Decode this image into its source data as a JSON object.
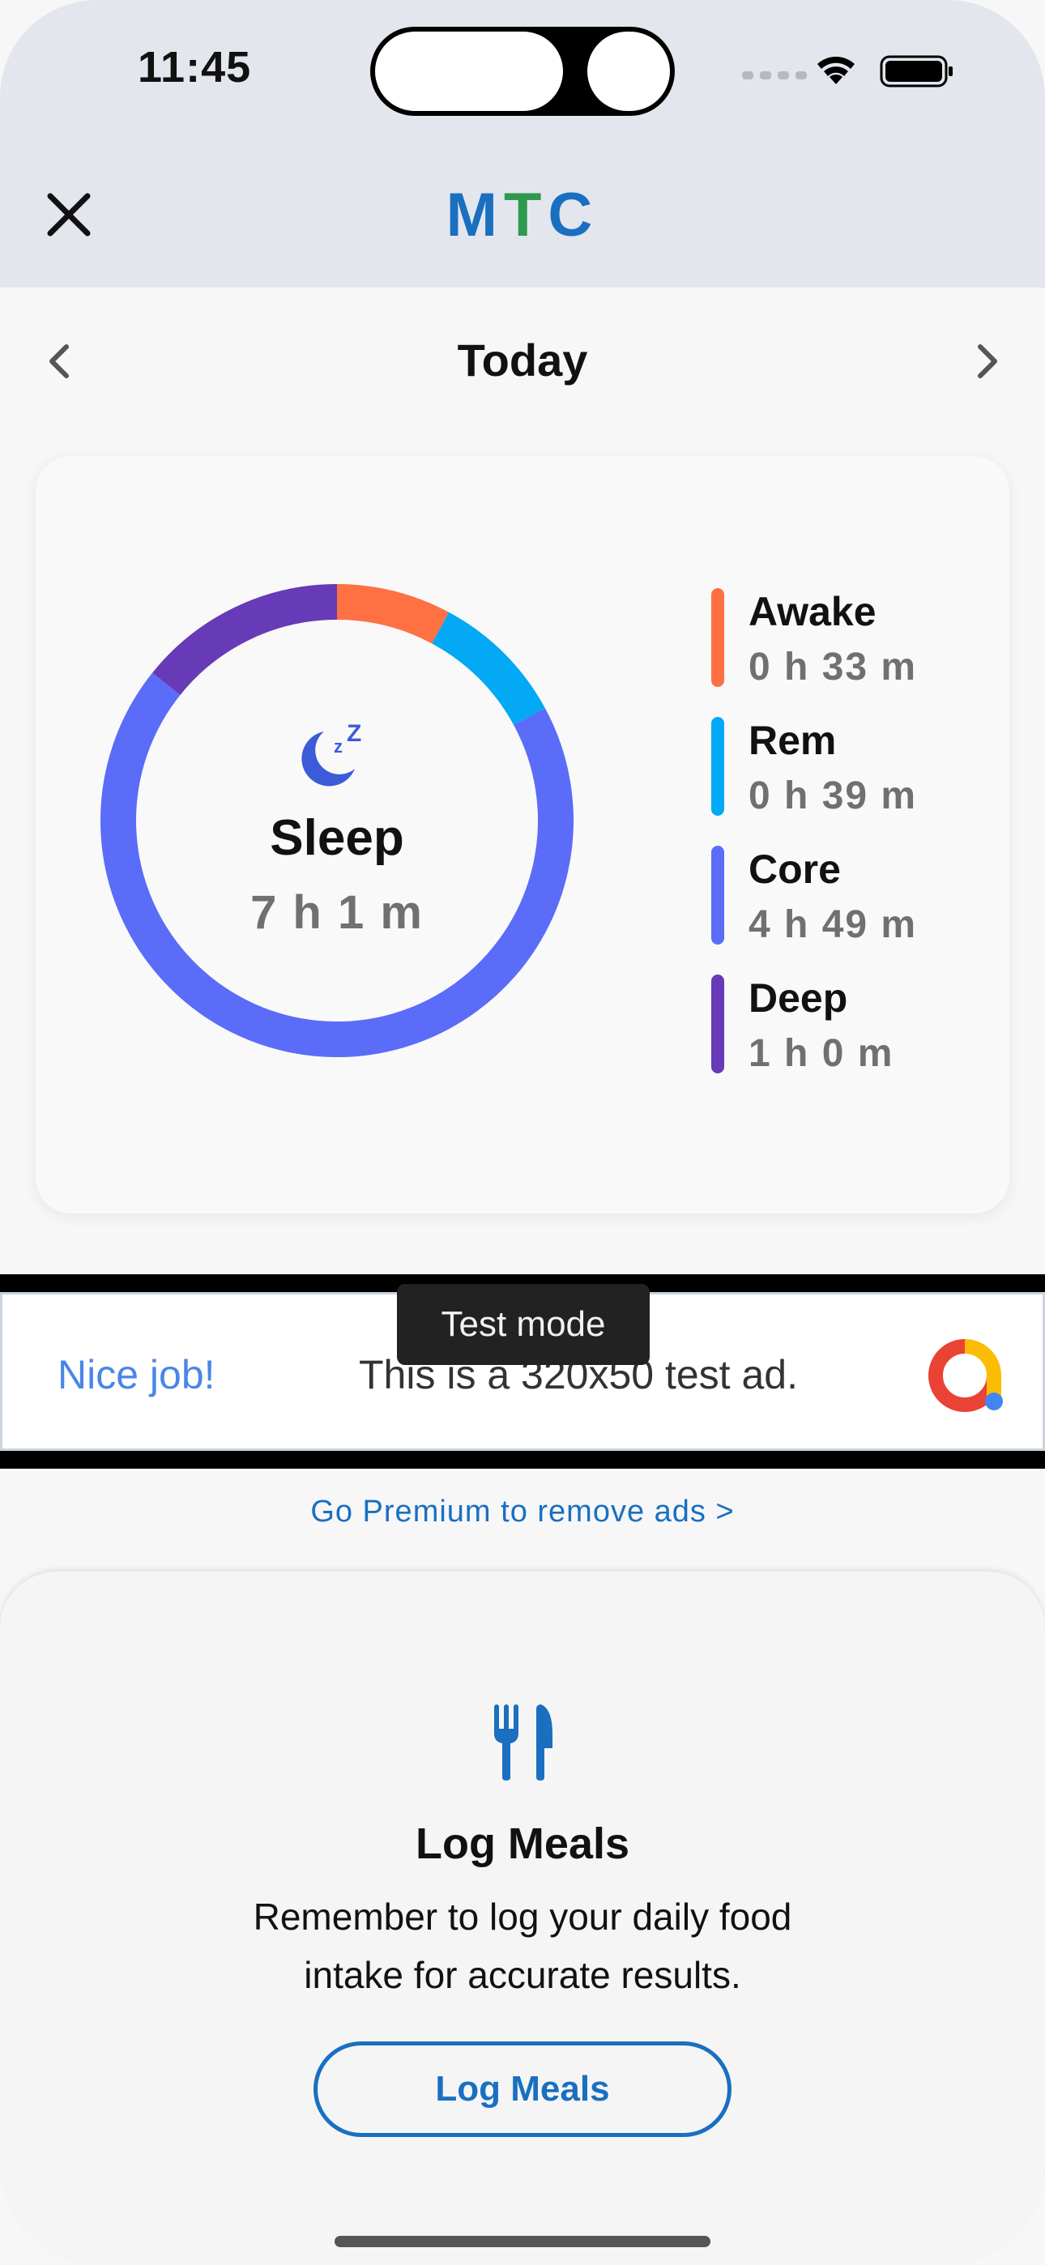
{
  "status_bar": {
    "time": "11:45",
    "icons": [
      "cellular-dots-icon",
      "wifi-icon",
      "battery-icon"
    ]
  },
  "header": {
    "close_icon": "close-icon",
    "logo_letters": [
      {
        "char": "M",
        "color": "#1a6fc0"
      },
      {
        "char": "T",
        "color": "#2e9a4e"
      },
      {
        "char": "C",
        "color": "#1a6fc0"
      }
    ]
  },
  "date_nav": {
    "title": "Today",
    "prev_icon": "chevron-left-icon",
    "next_icon": "chevron-right-icon"
  },
  "sleep": {
    "icon": "moon-zzz-icon",
    "label": "Sleep",
    "total": "7 h 1 m",
    "stages": [
      {
        "name": "Awake",
        "value": "0 h 33 m",
        "minutes": 33,
        "color": "#ff7043"
      },
      {
        "name": "Rem",
        "value": "0 h 39 m",
        "minutes": 39,
        "color": "#03a9f4"
      },
      {
        "name": "Core",
        "value": "4 h 49 m",
        "minutes": 289,
        "color": "#5a6cf8"
      },
      {
        "name": "Deep",
        "value": "1 h 0 m",
        "minutes": 60,
        "color": "#673ab7"
      }
    ]
  },
  "ad": {
    "tag": "Test mode",
    "headline": "Nice job!",
    "body": "This is a 320x50 test ad.",
    "logo_icon": "ad-logo-icon",
    "premium_link": "Go Premium to remove ads >"
  },
  "meal_card": {
    "icon": "fork-knife-icon",
    "title": "Log Meals",
    "description": "Remember to log your daily food intake for accurate results.",
    "button_label": "Log Meals"
  }
}
